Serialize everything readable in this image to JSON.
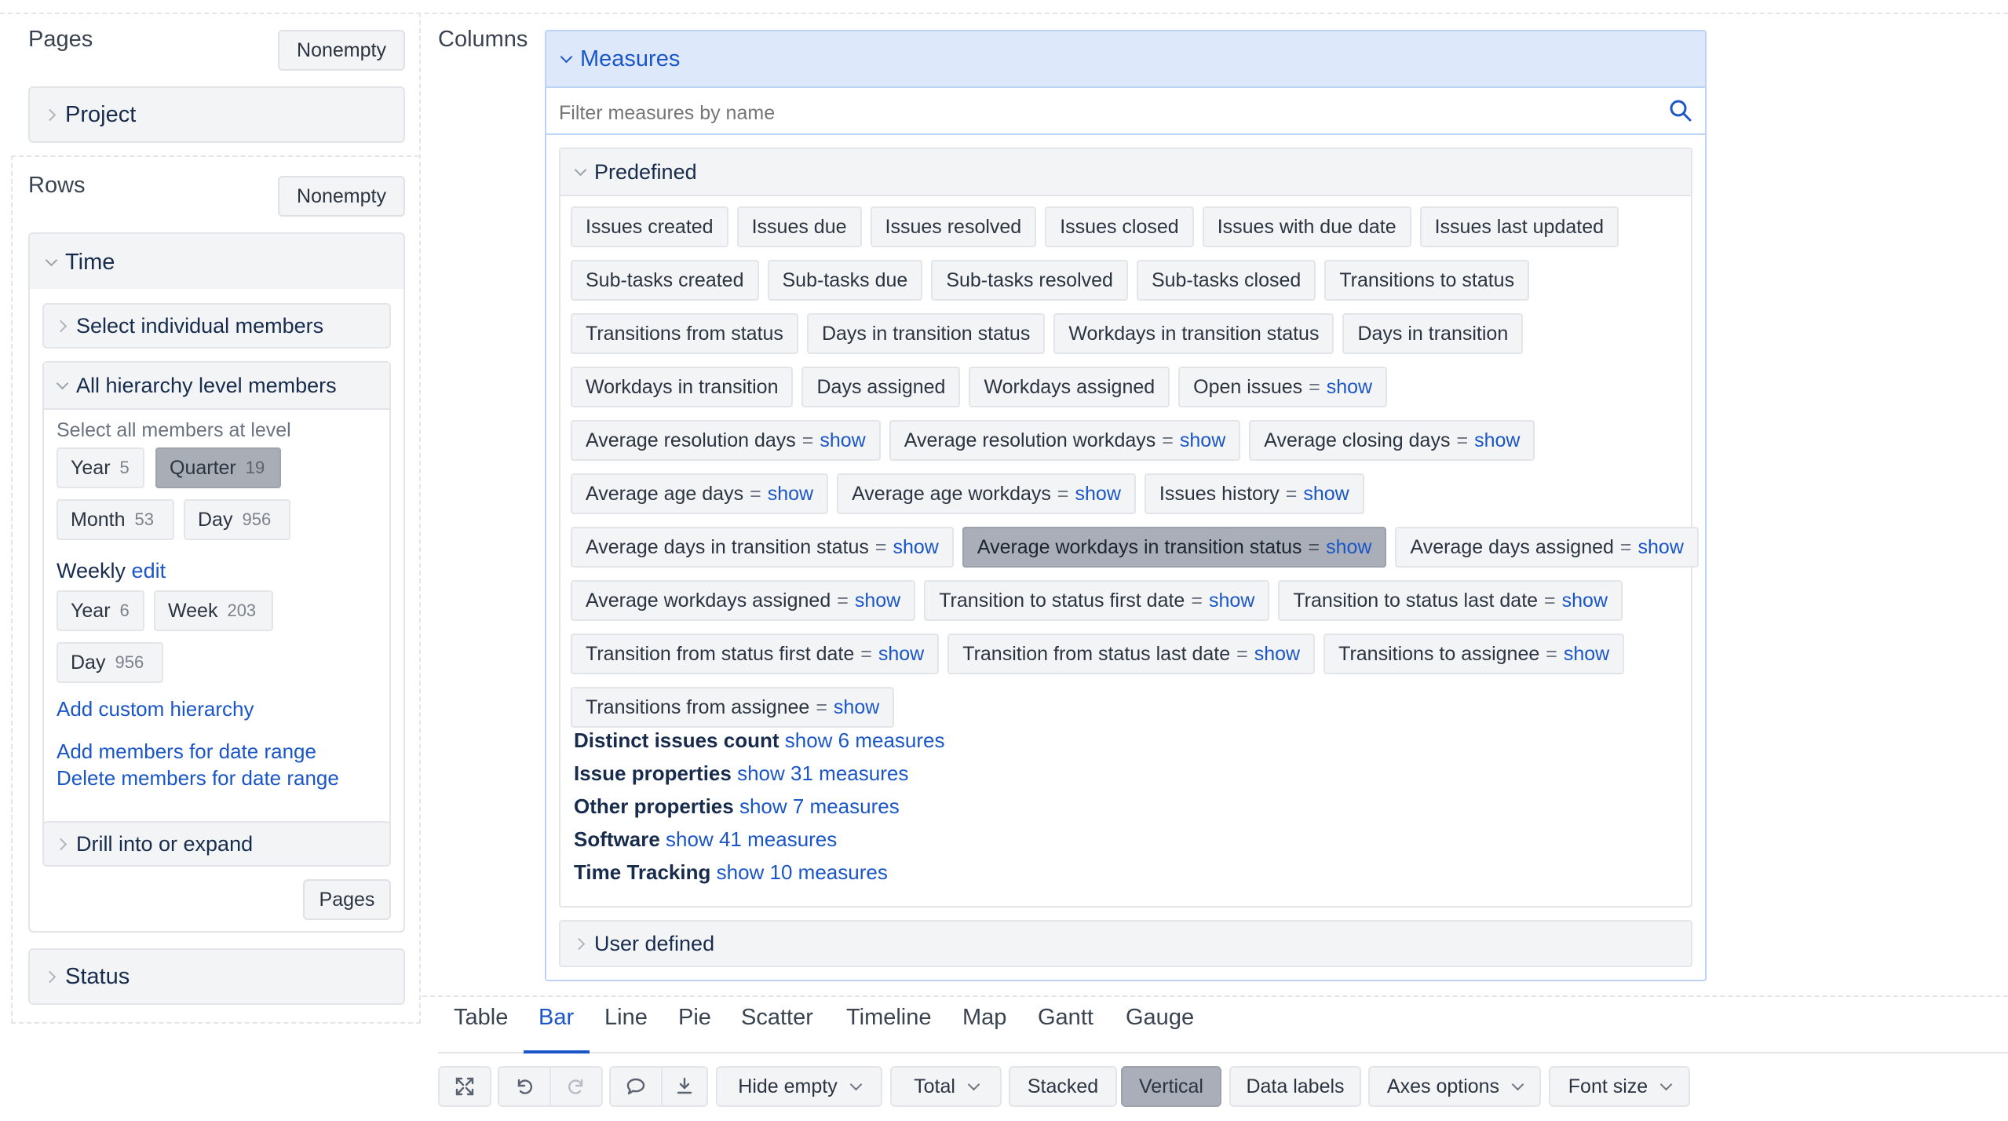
{
  "pages": {
    "title": "Pages",
    "nonempty_label": "Nonempty",
    "dimension": "Project"
  },
  "rows": {
    "title": "Rows",
    "nonempty_label": "Nonempty",
    "time": {
      "dimension": "Time",
      "select_individual": "Select individual members",
      "all_hierarchy": "All hierarchy level members",
      "select_all_caption": "Select all members at level",
      "levels": [
        {
          "name": "Year",
          "count": "5"
        },
        {
          "name": "Quarter",
          "count": "19"
        },
        {
          "name": "Month",
          "count": "53"
        },
        {
          "name": "Day",
          "count": "956"
        }
      ],
      "weekly_label": "Weekly",
      "weekly_edit": "edit",
      "weekly_levels": [
        {
          "name": "Year",
          "count": "6"
        },
        {
          "name": "Week",
          "count": "203"
        },
        {
          "name": "Day",
          "count": "956"
        }
      ],
      "add_custom_hierarchy": "Add custom hierarchy",
      "add_members_date_range": "Add members for date range",
      "delete_members_date_range": "Delete members for date range",
      "drill_into": "Drill into or expand",
      "pages_button": "Pages"
    },
    "status_dimension": "Status"
  },
  "columns": {
    "title": "Columns",
    "measures_title": "Measures",
    "filter_placeholder": "Filter measures by name",
    "predefined_title": "Predefined",
    "chips": [
      {
        "label": "Issues created"
      },
      {
        "label": "Issues due"
      },
      {
        "label": "Issues resolved"
      },
      {
        "label": "Issues closed"
      },
      {
        "label": "Issues with due date"
      },
      {
        "label": "Issues last updated"
      },
      {
        "label": "Sub-tasks created"
      },
      {
        "label": "Sub-tasks due"
      },
      {
        "label": "Sub-tasks resolved"
      },
      {
        "label": "Sub-tasks closed"
      },
      {
        "label": "Transitions to status"
      },
      {
        "label": "Transitions from status"
      },
      {
        "label": "Days in transition status"
      },
      {
        "label": "Workdays in transition status"
      },
      {
        "label": "Days in transition"
      },
      {
        "label": "Workdays in transition"
      },
      {
        "label": "Days assigned"
      },
      {
        "label": "Workdays assigned"
      },
      {
        "label": "Open issues",
        "eq": "=",
        "show": "show"
      },
      {
        "label": "Average resolution days",
        "eq": "=",
        "show": "show"
      },
      {
        "label": "Average resolution workdays",
        "eq": "=",
        "show": "show"
      },
      {
        "label": "Average closing days",
        "eq": "=",
        "show": "show"
      },
      {
        "label": "Average age days",
        "eq": "=",
        "show": "show"
      },
      {
        "label": "Average age workdays",
        "eq": "=",
        "show": "show"
      },
      {
        "label": "Issues history",
        "eq": "=",
        "show": "show"
      },
      {
        "label": "Average days in transition status",
        "eq": "=",
        "show": "show"
      },
      {
        "label": "Average workdays in transition status",
        "eq": "=",
        "show": "show",
        "selected": true
      },
      {
        "label": "Average days assigned",
        "eq": "=",
        "show": "show"
      },
      {
        "label": "Average workdays assigned",
        "eq": "=",
        "show": "show"
      },
      {
        "label": "Transition to status first date",
        "eq": "=",
        "show": "show"
      },
      {
        "label": "Transition to status last date",
        "eq": "=",
        "show": "show"
      },
      {
        "label": "Transition from status first date",
        "eq": "=",
        "show": "show"
      },
      {
        "label": "Transition from status last date",
        "eq": "=",
        "show": "show"
      },
      {
        "label": "Transitions to assignee",
        "eq": "=",
        "show": "show"
      },
      {
        "label": "Transitions from assignee",
        "eq": "=",
        "show": "show"
      }
    ],
    "groups": [
      {
        "name": "Distinct issues count",
        "link": "show 6 measures"
      },
      {
        "name": "Issue properties",
        "link": "show 31 measures"
      },
      {
        "name": "Other properties",
        "link": "show 7 measures"
      },
      {
        "name": "Software",
        "link": "show 41 measures"
      },
      {
        "name": "Time Tracking",
        "link": "show 10 measures"
      }
    ],
    "user_defined_title": "User defined"
  },
  "tabs": [
    "Table",
    "Bar",
    "Line",
    "Pie",
    "Scatter",
    "Timeline",
    "Map",
    "Gantt",
    "Gauge"
  ],
  "active_tab": "Bar",
  "toolbar": {
    "hide_empty": "Hide empty",
    "total": "Total",
    "stacked": "Stacked",
    "vertical": "Vertical",
    "data_labels": "Data labels",
    "axes_options": "Axes options",
    "font_size": "Font size"
  },
  "colors": {
    "accent": "#1a56c7",
    "selected_chip": "#a9aeb8",
    "measures_header": "#dde9fb"
  }
}
